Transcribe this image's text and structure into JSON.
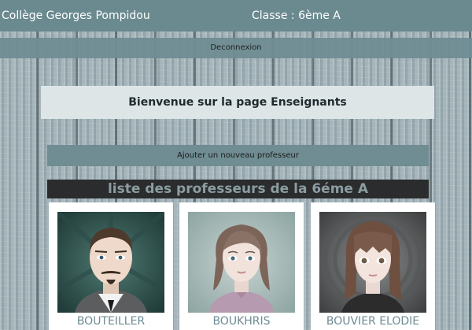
{
  "header": {
    "school": "Collège Georges Pompidou",
    "classe": "Classe : 6ème A"
  },
  "logout_label": "Deconnexion",
  "welcome_text": "Bienvenue sur la page Enseignants",
  "add_teacher_label": "Ajouter un nouveau professeur",
  "list_title": "liste des professeurs de la 6éme A",
  "teachers": [
    {
      "name": "BOUTEILLER"
    },
    {
      "name": "BOUKHRIS"
    },
    {
      "name": "BOUVIER ELODIE"
    }
  ],
  "colors": {
    "topbar": "#6a8a90",
    "accent_text": "#6d8b93",
    "title_bg": "#2a2c2d"
  }
}
